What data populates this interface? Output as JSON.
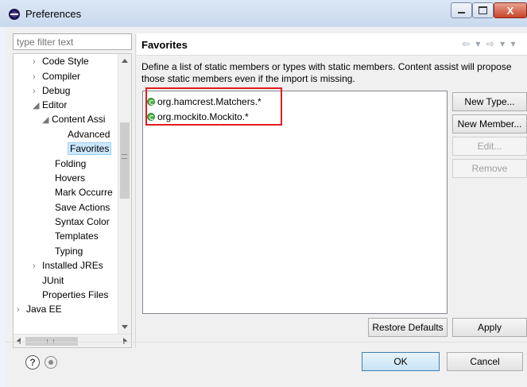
{
  "window": {
    "title": "Preferences",
    "close_label": "X"
  },
  "filter": {
    "placeholder": "type filter text"
  },
  "tree": {
    "items": [
      {
        "label": "Code Style",
        "arrow": "›"
      },
      {
        "label": "Compiler",
        "arrow": "›"
      },
      {
        "label": "Debug",
        "arrow": "›"
      },
      {
        "label": "Editor",
        "arrow": "◢"
      },
      {
        "label": "Content Assi",
        "arrow": "◢"
      },
      {
        "label": "Advanced",
        "arrow": ""
      },
      {
        "label": "Favorites",
        "arrow": "",
        "selected": true
      },
      {
        "label": "Folding",
        "arrow": ""
      },
      {
        "label": "Hovers",
        "arrow": ""
      },
      {
        "label": "Mark Occurre",
        "arrow": ""
      },
      {
        "label": "Save Actions",
        "arrow": ""
      },
      {
        "label": "Syntax Color",
        "arrow": ""
      },
      {
        "label": "Templates",
        "arrow": ""
      },
      {
        "label": "Typing",
        "arrow": ""
      },
      {
        "label": "Installed JREs",
        "arrow": "›"
      },
      {
        "label": "JUnit",
        "arrow": ""
      },
      {
        "label": "Properties Files",
        "arrow": ""
      },
      {
        "label": "Java EE",
        "arrow": "›"
      }
    ]
  },
  "page": {
    "title": "Favorites",
    "nav": "⇦ ▾ ⇨ ▾ ▾",
    "description": "Define a list of static members or types with static members. Content assist will propose those static members even if the import is missing.",
    "favorites": [
      "org.hamcrest.Matchers.*",
      "org.mockito.Mockito.*"
    ],
    "buttons": {
      "new_type": "New Type...",
      "new_member": "New Member...",
      "edit": "Edit...",
      "remove": "Remove",
      "restore_defaults": "Restore Defaults",
      "apply": "Apply"
    }
  },
  "footer": {
    "ok": "OK",
    "cancel": "Cancel",
    "help": "?"
  }
}
